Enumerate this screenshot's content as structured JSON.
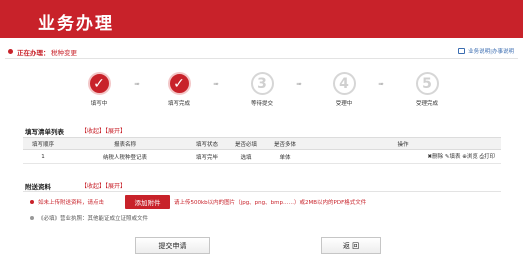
{
  "banner": {
    "title": "业务办理"
  },
  "status": {
    "label": "正在办理：",
    "value": "税种变更",
    "guide": "业务说明|办事说明"
  },
  "steps": [
    {
      "label": "填写中",
      "glyph": "✓",
      "state": "done"
    },
    {
      "label": "填写完成",
      "glyph": "✓",
      "state": "done"
    },
    {
      "label": "等待提交",
      "glyph": "3",
      "state": "todo"
    },
    {
      "label": "受理中",
      "glyph": "4",
      "state": "todo"
    },
    {
      "label": "受理完成",
      "glyph": "5",
      "state": "todo"
    }
  ],
  "form_list": {
    "title": "填写清单列表",
    "links": "【收起】【展开】",
    "columns": [
      "填写顺序",
      "报表名称",
      "填写状态",
      "是否必填",
      "是否多体",
      "操作"
    ],
    "rows": [
      {
        "order": "1",
        "name": "纳税人税种登记表",
        "status": "填写完毕",
        "required": "选填",
        "multi": "单体",
        "ops": "✖删除 ✎填表 ⊕浏览 ⎙打印"
      }
    ]
  },
  "attachments": {
    "title": "附送资料",
    "links": "【收起】【展开】",
    "note1_prefix": "如未上传附送资料，请点击",
    "add_button": "添加附件",
    "note1_suffix": "请上传500kb以内的图片（jpg、png、bmp……）或2MB以内的PDF格式文件",
    "note2": "《必填》营业执照：其他能证成立证照或文件"
  },
  "buttons": {
    "submit": "提交申请",
    "back": "返 回"
  },
  "colors": {
    "brand": "#c8222a"
  }
}
